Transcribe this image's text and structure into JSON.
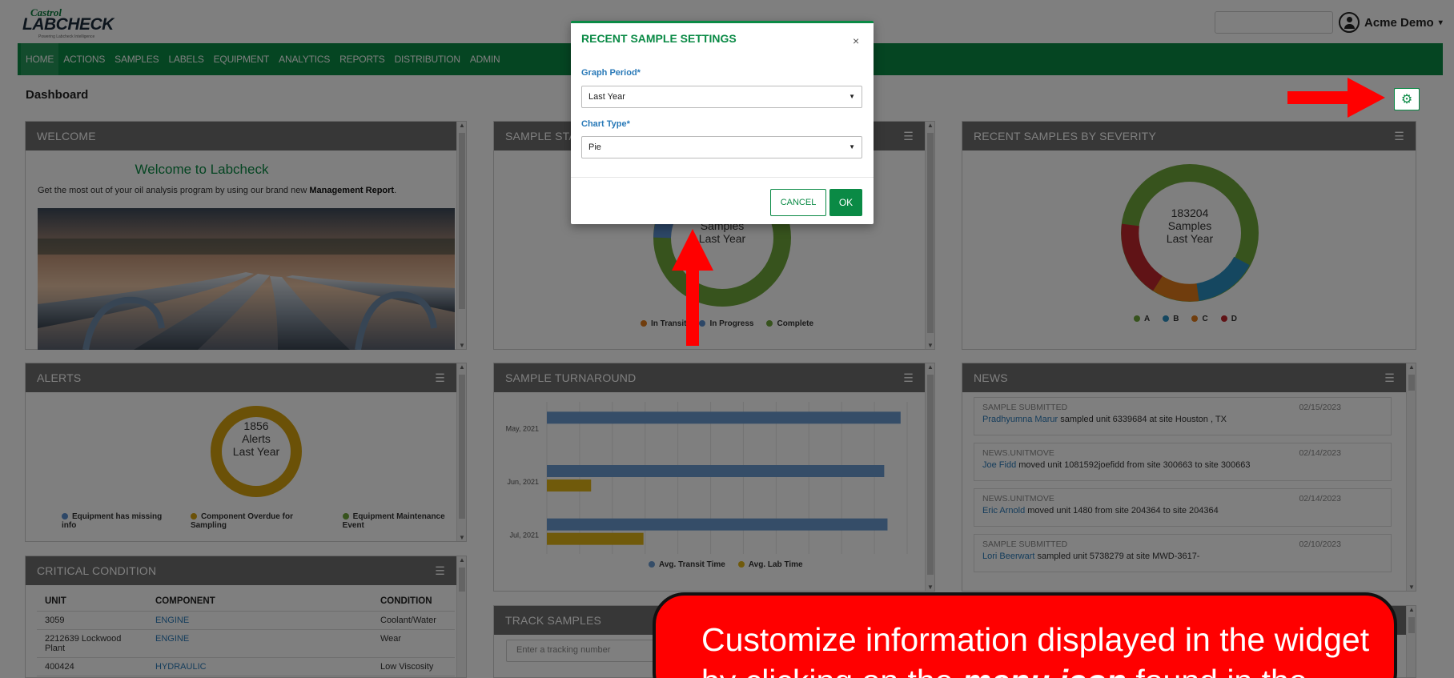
{
  "header": {
    "brand_top": "Castrol",
    "brand_main": "LABCHECK",
    "brand_tagline": "Powering Labcheck Intelligence",
    "user_name": "Acme Demo"
  },
  "nav": {
    "items": [
      "HOME",
      "ACTIONS",
      "SAMPLES",
      "LABELS",
      "EQUIPMENT",
      "ANALYTICS",
      "REPORTS",
      "DISTRIBUTION",
      "ADMIN"
    ]
  },
  "page": {
    "title": "Dashboard"
  },
  "welcome": {
    "title": "WELCOME",
    "heading": "Welcome to Labcheck",
    "text_pre": "Get the most out of your oil analysis program by using our brand new ",
    "text_bold": "Management Report",
    "text_post": "."
  },
  "sample_status": {
    "title": "SAMPLE STATUS",
    "center_line2": "Samples",
    "center_line3": "Last Year",
    "legend": [
      "In Transit",
      "In Progress",
      "Complete"
    ]
  },
  "severity": {
    "title": "RECENT SAMPLES BY SEVERITY",
    "center_line1": "183204",
    "center_line2": "Samples",
    "center_line3": "Last Year",
    "legend": [
      "A",
      "B",
      "C",
      "D"
    ]
  },
  "alerts": {
    "title": "ALERTS",
    "center_line1": "1856",
    "center_line2": "Alerts",
    "center_line3": "Last Year",
    "legend": [
      "Equipment has missing info",
      "Component Overdue for Sampling",
      "Equipment Maintenance Event"
    ]
  },
  "turnaround": {
    "title": "SAMPLE TURNAROUND",
    "legend": [
      "Avg. Transit Time",
      "Avg. Lab Time"
    ]
  },
  "chart_data": {
    "type": "bar",
    "orientation": "horizontal",
    "categories": [
      "May, 2021",
      "Jun, 2021",
      "Jul, 2021"
    ],
    "series": [
      {
        "name": "Avg. Transit Time",
        "values": [
          10.8,
          10.3,
          10.4
        ],
        "color": "#6b9bd1"
      },
      {
        "name": "Avg. Lab Time",
        "values": [
          0,
          1.35,
          2.95
        ],
        "color": "#e0b417"
      }
    ],
    "xlim": [
      0,
      11
    ],
    "xticks": [
      "0",
      "1",
      "2",
      "3",
      "4",
      "5",
      "6",
      "7",
      "8",
      "9",
      "10",
      "11"
    ],
    "grid": true,
    "legend_position": "bottom"
  },
  "news": {
    "title": "NEWS",
    "items": [
      {
        "type": "SAMPLE SUBMITTED",
        "date": "02/15/2023",
        "actor": "Pradhyumna Marur",
        "text": " sampled unit 6339684 at site Houston , TX"
      },
      {
        "type": "NEWS.UNITMOVE",
        "date": "02/14/2023",
        "actor": "Joe Fidd",
        "text": " moved unit 1081592joefidd from site 300663 to site 300663"
      },
      {
        "type": "NEWS.UNITMOVE",
        "date": "02/14/2023",
        "actor": "Eric Arnold",
        "text": " moved unit 1480 from site 204364 to site 204364"
      },
      {
        "type": "SAMPLE SUBMITTED",
        "date": "02/10/2023",
        "actor": "Lori Beerwart",
        "text": " sampled unit 5738279 at site MWD-3617-"
      }
    ]
  },
  "critical": {
    "title": "CRITICAL CONDITION",
    "columns": [
      "UNIT",
      "COMPONENT",
      "CONDITION"
    ],
    "rows": [
      [
        "3059",
        "ENGINE",
        "Coolant/Water"
      ],
      [
        "2212639 Lockwood Plant",
        "ENGINE",
        "Wear"
      ],
      [
        "400424",
        "HYDRAULIC",
        "Low Viscosity"
      ]
    ]
  },
  "track": {
    "title": "TRACK SAMPLES",
    "placeholder": "Enter a tracking number"
  },
  "modal": {
    "title": "RECENT SAMPLE SETTINGS",
    "close": "×",
    "graph_period_label": "Graph Period*",
    "graph_period_value": "Last Year",
    "chart_type_label": "Chart Type*",
    "chart_type_value": "Pie",
    "cancel": "CANCEL",
    "ok": "OK"
  },
  "callout": {
    "line1": "Customize information displayed in the widget",
    "line2_pre": "by clicking on the ",
    "line2_em": "menu icon",
    "line2_post": " found in the"
  },
  "colors": {
    "brand_green": "#0a8a45",
    "header_gray": "#6f6f6f",
    "link_blue": "#2a7ab8",
    "callout_red": "#ff0000"
  }
}
